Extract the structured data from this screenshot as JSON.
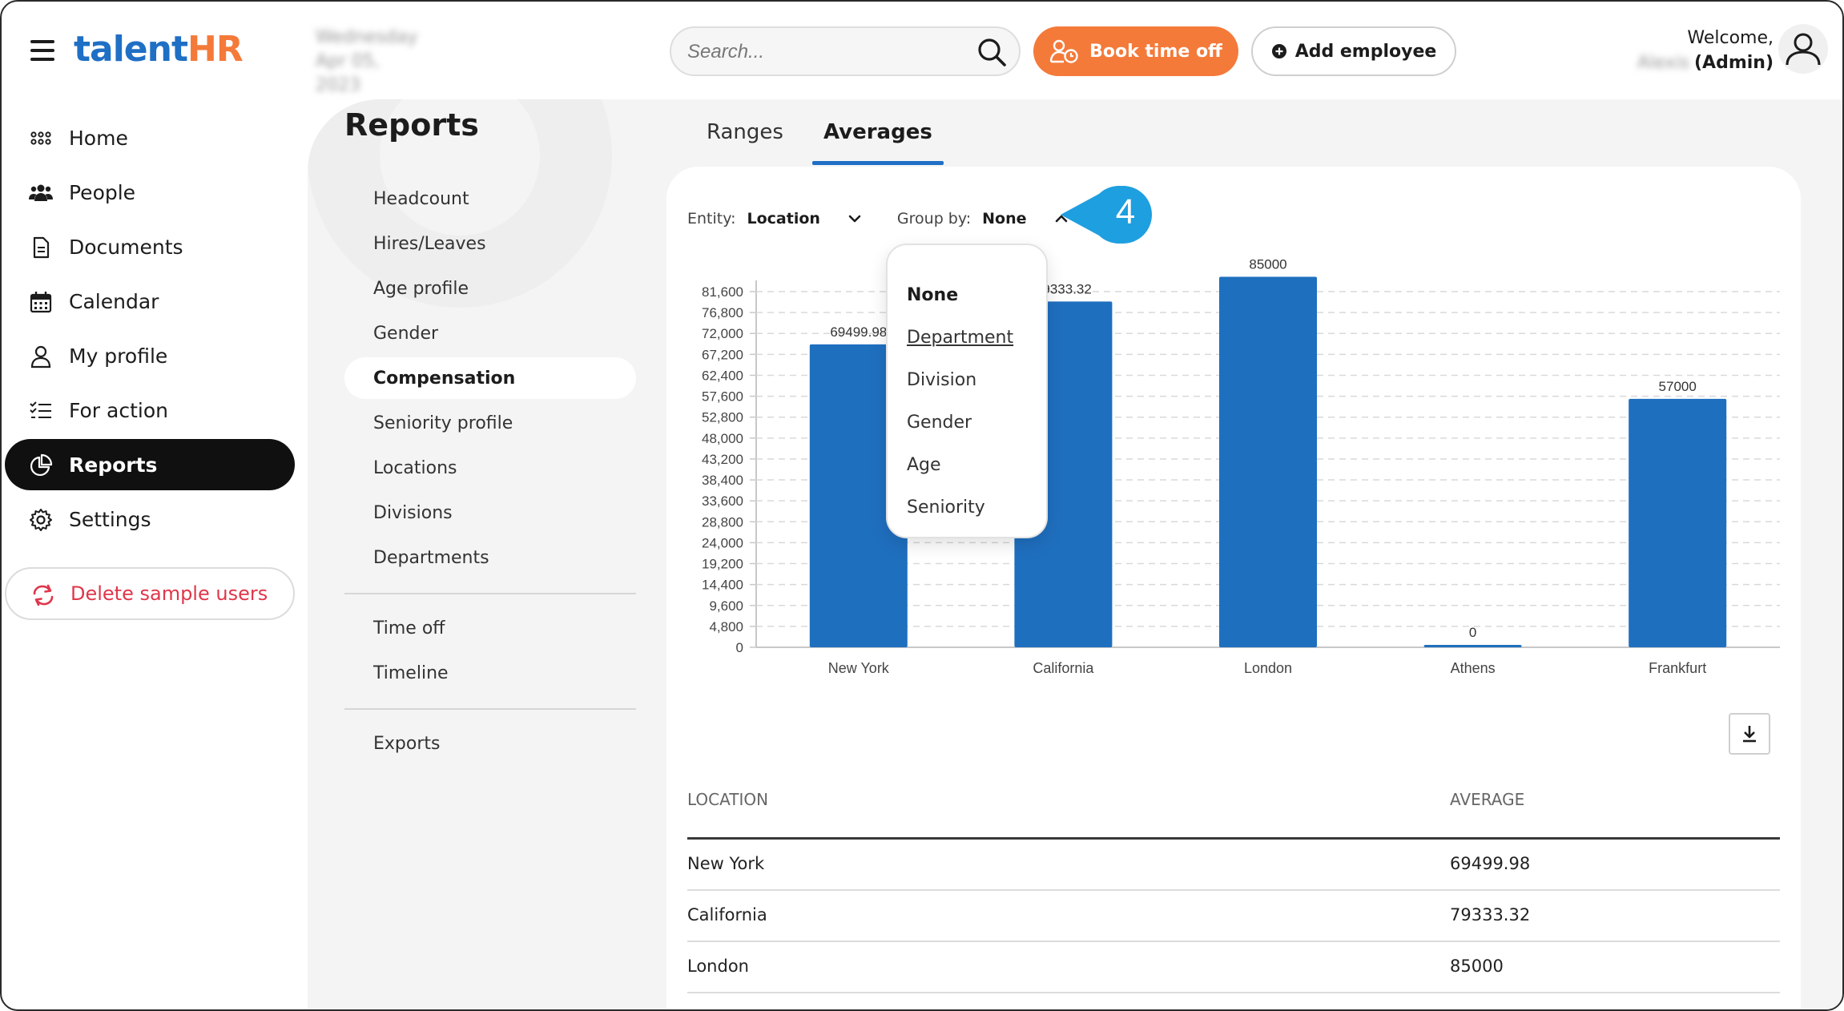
{
  "header": {
    "logo_part1": "talent",
    "logo_part2": "HR",
    "date_line1": "Wednesday",
    "date_line2": "Apr 05, 2023",
    "search_placeholder": "Search...",
    "book_time_off": "Book time off",
    "add_employee": "Add employee",
    "welcome": "Welcome,",
    "user_name": "Alexis",
    "user_role": "(Admin)"
  },
  "sidebar": {
    "items": [
      {
        "label": "Home",
        "icon": "grid-dots-icon"
      },
      {
        "label": "People",
        "icon": "people-icon"
      },
      {
        "label": "Documents",
        "icon": "document-icon"
      },
      {
        "label": "Calendar",
        "icon": "calendar-icon"
      },
      {
        "label": "My profile",
        "icon": "user-icon"
      },
      {
        "label": "For action",
        "icon": "checklist-icon"
      },
      {
        "label": "Reports",
        "icon": "pie-chart-icon"
      },
      {
        "label": "Settings",
        "icon": "gear-icon"
      }
    ],
    "active": "Reports",
    "delete_sample_users": "Delete sample users"
  },
  "reports_menu": {
    "title": "Reports",
    "group1": [
      "Headcount",
      "Hires/Leaves",
      "Age profile",
      "Gender",
      "Compensation",
      "Seniority profile",
      "Locations",
      "Divisions",
      "Departments"
    ],
    "group2": [
      "Time off",
      "Timeline"
    ],
    "group3": [
      "Exports"
    ],
    "active": "Compensation"
  },
  "tabs": {
    "items": [
      "Ranges",
      "Averages"
    ],
    "active": "Averages"
  },
  "filters": {
    "entity_label": "Entity:",
    "entity_value": "Location",
    "group_label": "Group by:",
    "group_value": "None"
  },
  "callout_number": "4",
  "dropdown": {
    "options": [
      "None",
      "Department",
      "Division",
      "Gender",
      "Age",
      "Seniority"
    ],
    "selected": "None",
    "hovered": "Department"
  },
  "chart_data": {
    "type": "bar",
    "categories": [
      "New York",
      "California",
      "London",
      "Athens",
      "Frankfurt"
    ],
    "values": [
      69499.98,
      79333.32,
      85000,
      0,
      57000
    ],
    "data_labels": [
      "69499.98",
      "79333.32",
      "85000",
      "0",
      "57000"
    ],
    "yticks": [
      "0",
      "4,800",
      "9,600",
      "14,400",
      "19,200",
      "24,000",
      "28,800",
      "33,600",
      "38,400",
      "43,200",
      "48,000",
      "52,800",
      "57,600",
      "62,400",
      "67,200",
      "72,000",
      "76,800",
      "81,600"
    ],
    "ylim": [
      0,
      81600
    ],
    "grid": true,
    "bar_color": "#1f6fbf"
  },
  "table": {
    "headers": [
      "Location",
      "Average"
    ],
    "rows": [
      [
        "New York",
        "69499.98"
      ],
      [
        "California",
        "79333.32"
      ],
      [
        "London",
        "85000"
      ]
    ]
  },
  "colors": {
    "brand_blue": "#1f6fc5",
    "brand_orange": "#f47a3a",
    "danger": "#e0364a",
    "callout": "#1e9fe0"
  }
}
